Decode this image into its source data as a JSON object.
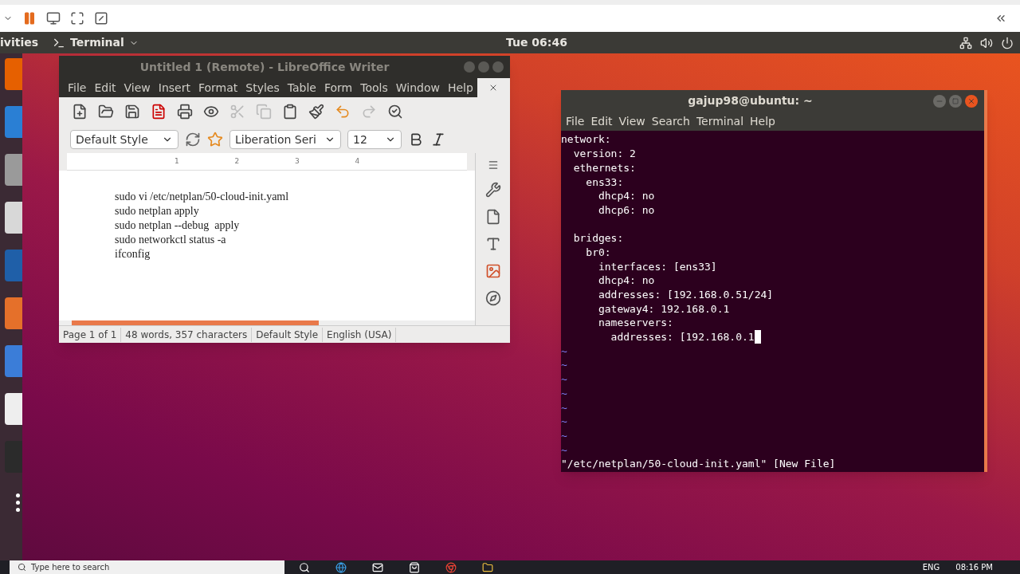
{
  "top_bar": {
    "activities": "ivities",
    "app_menu": "Terminal",
    "clock": "Tue 06:46"
  },
  "writer": {
    "title": "Untitled 1 (Remote) - LibreOffice Writer",
    "menu": [
      "File",
      "Edit",
      "View",
      "Insert",
      "Format",
      "Styles",
      "Table",
      "Form",
      "Tools",
      "Window",
      "Help"
    ],
    "paragraph_style": "Default Style",
    "font_name": "Liberation Seri",
    "font_size": "12",
    "ruler_numbers": [
      "1",
      "2",
      "3",
      "4"
    ],
    "document_lines": [
      "sudo vi /etc/netplan/50-cloud-init.yaml",
      "sudo netplan apply",
      "sudo netplan --debug  apply",
      "sudo networkctl status -a",
      "ifconfig"
    ],
    "status_bar": [
      "Page 1 of 1",
      "48 words, 357 characters",
      "Default Style",
      "English (USA)"
    ]
  },
  "terminal": {
    "title": "gajup98@ubuntu: ~",
    "menu": [
      "File",
      "Edit",
      "View",
      "Search",
      "Terminal",
      "Help"
    ],
    "lines": [
      {
        "text": "network:",
        "cursor": false
      },
      {
        "text": "  version: 2",
        "cursor": false
      },
      {
        "text": "  ethernets:",
        "cursor": false
      },
      {
        "text": "    ens33:",
        "cursor": false
      },
      {
        "text": "      dhcp4: no",
        "cursor": false
      },
      {
        "text": "      dhcp6: no",
        "cursor": false
      },
      {
        "kind": "blank",
        "cursor": false
      },
      {
        "text": "  bridges:",
        "cursor": false
      },
      {
        "text": "    br0:",
        "cursor": false
      },
      {
        "text": "      interfaces: [ens33]",
        "cursor": false
      },
      {
        "text": "      dhcp4: no",
        "cursor": false
      },
      {
        "text": "      addresses: [192.168.0.51/24]",
        "cursor": false
      },
      {
        "text": "      gateway4: 192.168.0.1",
        "cursor": false
      },
      {
        "text": "      nameservers:",
        "cursor": false
      },
      {
        "text": "        addresses: [192.168.0.1",
        "cursor": true
      },
      {
        "text": "~",
        "cursor": false
      },
      {
        "text": "~",
        "cursor": false
      },
      {
        "text": "~",
        "cursor": false
      },
      {
        "text": "~",
        "cursor": false
      },
      {
        "text": "~",
        "cursor": false
      },
      {
        "text": "~",
        "cursor": false
      },
      {
        "text": "~",
        "cursor": false
      },
      {
        "text": "~",
        "cursor": false
      }
    ],
    "status_line": "\"/etc/netplan/50-cloud-init.yaml\" [New File]"
  },
  "taskbar": {
    "search_placeholder": "Type here to search",
    "language": "ENG",
    "time": "08:16 PM"
  }
}
